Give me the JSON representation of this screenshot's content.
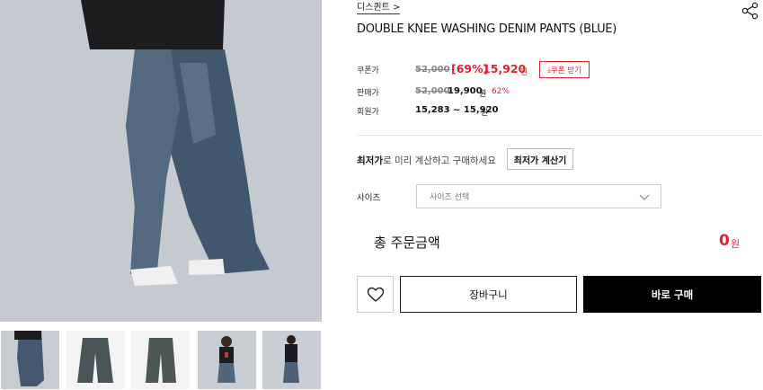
{
  "product": {
    "brand": "디스퀸트",
    "title": "DOUBLE KNEE WASHING DENIM PANTS (BLUE)"
  },
  "icons": {
    "share": "share-icon",
    "heart": "heart-icon",
    "chevron": "chevron-down-icon",
    "download": "download-icon"
  },
  "prices": {
    "coupon": {
      "label": "쿠폰가",
      "original": "52,000",
      "discount": "[69%]",
      "price": "15,920",
      "won": "원",
      "button": "쿠폰 받기"
    },
    "sale": {
      "label": "판매가",
      "original": "52,000",
      "price": "19,900",
      "won": "원",
      "discount": "62%"
    },
    "member": {
      "label": "회원가",
      "range": "15,283 ~ 15,920",
      "won": "원"
    }
  },
  "calc": {
    "strong": "최저가",
    "text": "로 미리 계산하고 구매하세요",
    "button": "최저가 계산기"
  },
  "size": {
    "label": "사이즈",
    "placeholder": "사이즈 선택"
  },
  "total": {
    "label": "총 주문금액",
    "amount": "0",
    "won": "원"
  },
  "actions": {
    "cart": "장바구니",
    "buy": "바로 구매"
  },
  "colors": {
    "accent": "#e0222c",
    "buy_bg": "#000000"
  }
}
